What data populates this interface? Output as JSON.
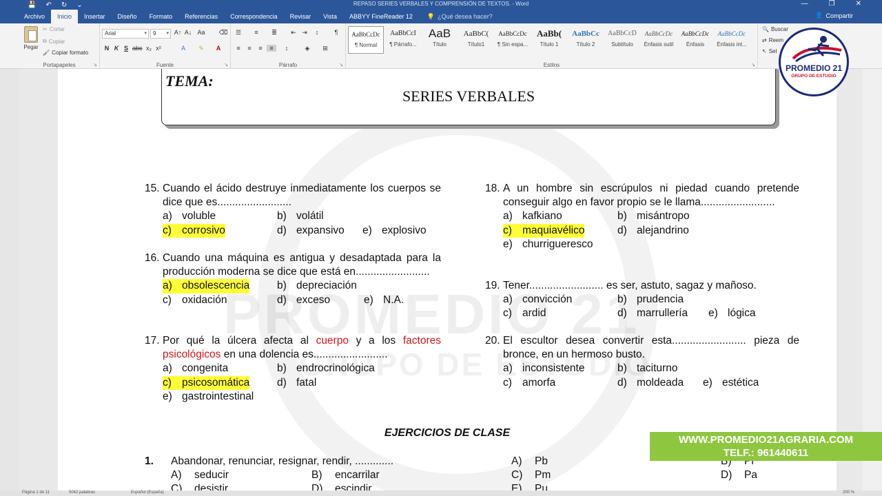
{
  "window": {
    "title": "REPASO SERIES VERBALES Y COMPRENSIÓN DE TEXTOS. - Word",
    "controls": [
      "—",
      "❐",
      "✕"
    ]
  },
  "tabs": [
    "Archivo",
    "Inicio",
    "Insertar",
    "Diseño",
    "Formato",
    "Referencias",
    "Correspondencia",
    "Revisar",
    "Vista",
    "ABBYY FineReader 12"
  ],
  "tell_me": "¿Qué desea hacer?",
  "share": "Compartir",
  "ribbon": {
    "clipboard": {
      "paste": "Pegar",
      "cut": "Cortar",
      "copy": "Copiar",
      "format_painter": "Copiar formato",
      "label": "Portapapeles"
    },
    "font": {
      "name": "Arial",
      "size": "9",
      "label": "Fuente"
    },
    "paragraph": {
      "label": "Párrafo"
    },
    "styles": {
      "label": "Estilos",
      "items": [
        {
          "sample": "AaBbCcDc",
          "name": "¶ Normal"
        },
        {
          "sample": "AaBbCcI",
          "name": "¶ Párrafo..."
        },
        {
          "sample": "AaB",
          "name": "Título"
        },
        {
          "sample": "AaBbC(",
          "name": "Título1"
        },
        {
          "sample": "AaBbCcDc",
          "name": "¶ Sin espa..."
        },
        {
          "sample": "AaBb(",
          "name": "Título 1"
        },
        {
          "sample": "AaBbCc",
          "name": "Título 2"
        },
        {
          "sample": "AaBbCcD",
          "name": "Subtítulo"
        },
        {
          "sample": "AaBbCcDc",
          "name": "Énfasis sutil"
        },
        {
          "sample": "AaBbCcDc",
          "name": "Énfasis"
        },
        {
          "sample": "AaBbCcDc",
          "name": "Énfasis int..."
        }
      ]
    },
    "editing": {
      "find": "Buscar",
      "replace": "Reem",
      "select": "Sel"
    }
  },
  "document": {
    "tema_label": "TEMA:",
    "tema_title": "SERIES VERBALES",
    "watermark": [
      "PROMEDIO 21",
      "GRUPO DE ESTUDIO"
    ],
    "questions": {
      "q15": {
        "num": "15.",
        "stem": "Cuando el ácido destruye inmediatamente los cuerpos se dice que es.........................",
        "a": "voluble",
        "b": "volátil",
        "c": "corrosivo",
        "d": "expansivo",
        "e": "explosivo"
      },
      "q16": {
        "num": "16.",
        "stem": "Cuando una máquina es antigua y desadaptada para la producción moderna se dice que está en.........................",
        "a": "obsolescencia",
        "b": "depreciación",
        "c": "oxidación",
        "d": "exceso",
        "e": "N.A."
      },
      "q17": {
        "num": "17.",
        "stem_1": "Por qué la úlcera afecta al",
        "stem_red1": "cuerpo",
        "stem_2": "y a los",
        "stem_red2": "factores psicológicos",
        "stem_3": "en una dolencia es.........................",
        "a": "congenita",
        "b": "endrocrinológica",
        "c": "psicosomática",
        "d": "fatal",
        "e": "gastrointestinal"
      },
      "q18": {
        "num": "18.",
        "stem": "A un hombre sin escrúpulos ni piedad cuando pretende conseguir algo en favor propio se le llama.........................",
        "a": "kafkiano",
        "b": "misántropo",
        "c": "maquiavélico",
        "d": "alejandrino",
        "e": "churrigueresco"
      },
      "q19": {
        "num": "19.",
        "stem": "Tener......................... es ser, astuto, sagaz y mañoso.",
        "a": "convicción",
        "b": "prudencia",
        "c": "ardid",
        "d": "marrullería",
        "e": "lógica"
      },
      "q20": {
        "num": "20.",
        "stem": "El escultor desea convertir esta......................... pieza de bronce, en un hermoso busto.",
        "a": "inconsistente",
        "b": "taciturno",
        "c": "amorfa",
        "d": "moldeada",
        "e": "estética"
      }
    },
    "labels": {
      "a": "a)",
      "b": "b)",
      "c": "c)",
      "d": "d)",
      "e": "e)"
    },
    "ejercicios": "EJERCICIOS DE CLASE",
    "ex1": {
      "num": "1.",
      "stem": "Abandonar, renunciar, resignar, rendir, .............",
      "A": "seducir",
      "B": "encarrilar",
      "C": "desistir",
      "D": "escindir",
      "rA": "Pb",
      "rB": "Pl",
      "rC": "Pm",
      "rD": "Pa",
      "rE": "Pu",
      "L": {
        "A": "A)",
        "B": "B)",
        "C": "C)",
        "D": "D)",
        "E": "E)"
      }
    }
  },
  "status": {
    "page": "Página 1 de 11",
    "words": "5042 palabras",
    "lang": "Español (España)",
    "zoom": "200 %"
  },
  "logo": {
    "name": "PROMEDIO 21",
    "subtitle": "GRUPO DE ESTUDIO"
  },
  "promo": {
    "url": "WWW.PROMEDIO21AGRARIA.COM",
    "phone": "TELF.: 961440611"
  },
  "colors": {
    "word_blue": "#2b579a",
    "highlight": "#ffff37",
    "red_text": "#d0161b",
    "promo_green": "#8ec63f"
  }
}
